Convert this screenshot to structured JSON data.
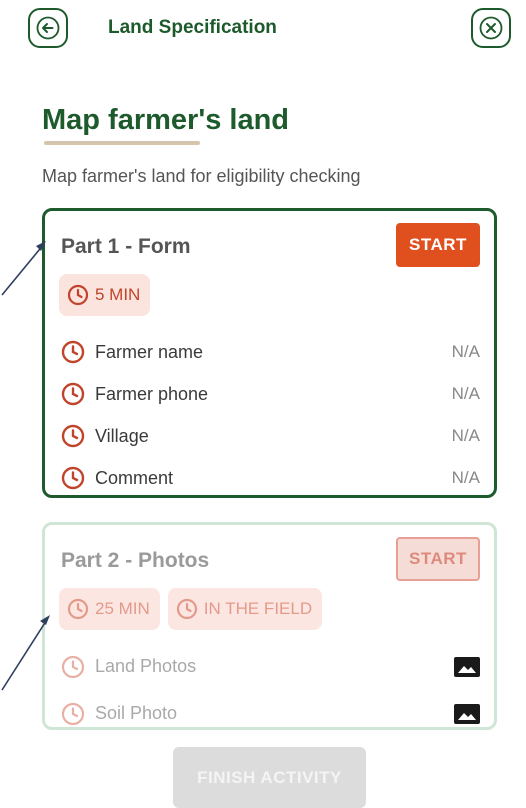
{
  "header": {
    "title": "Land Specification",
    "back_icon": "arrow-left-icon",
    "close_icon": "close-icon"
  },
  "page": {
    "title": "Map farmer's land",
    "subtitle": "Map farmer's land for eligibility checking"
  },
  "parts": [
    {
      "title": "Part 1 - Form",
      "start_label": "START",
      "badges": [
        "5 MIN"
      ],
      "items": [
        {
          "label": "Farmer name",
          "value": "N/A"
        },
        {
          "label": "Farmer phone",
          "value": "N/A"
        },
        {
          "label": "Village",
          "value": "N/A"
        },
        {
          "label": "Comment",
          "value": "N/A"
        }
      ]
    },
    {
      "title": "Part 2 - Photos",
      "start_label": "START",
      "badges": [
        "25 MIN",
        "IN THE FIELD"
      ],
      "items": [
        {
          "label": "Land Photos",
          "icon": "image-icon"
        },
        {
          "label": "Soil Photo",
          "icon": "image-icon"
        }
      ]
    }
  ],
  "footer": {
    "finish_label": "FINISH ACTIVITY"
  },
  "colors": {
    "brand_green": "#1d5a2c",
    "accent_orange": "#e0501f",
    "underline_beige": "#d4c5ad"
  }
}
